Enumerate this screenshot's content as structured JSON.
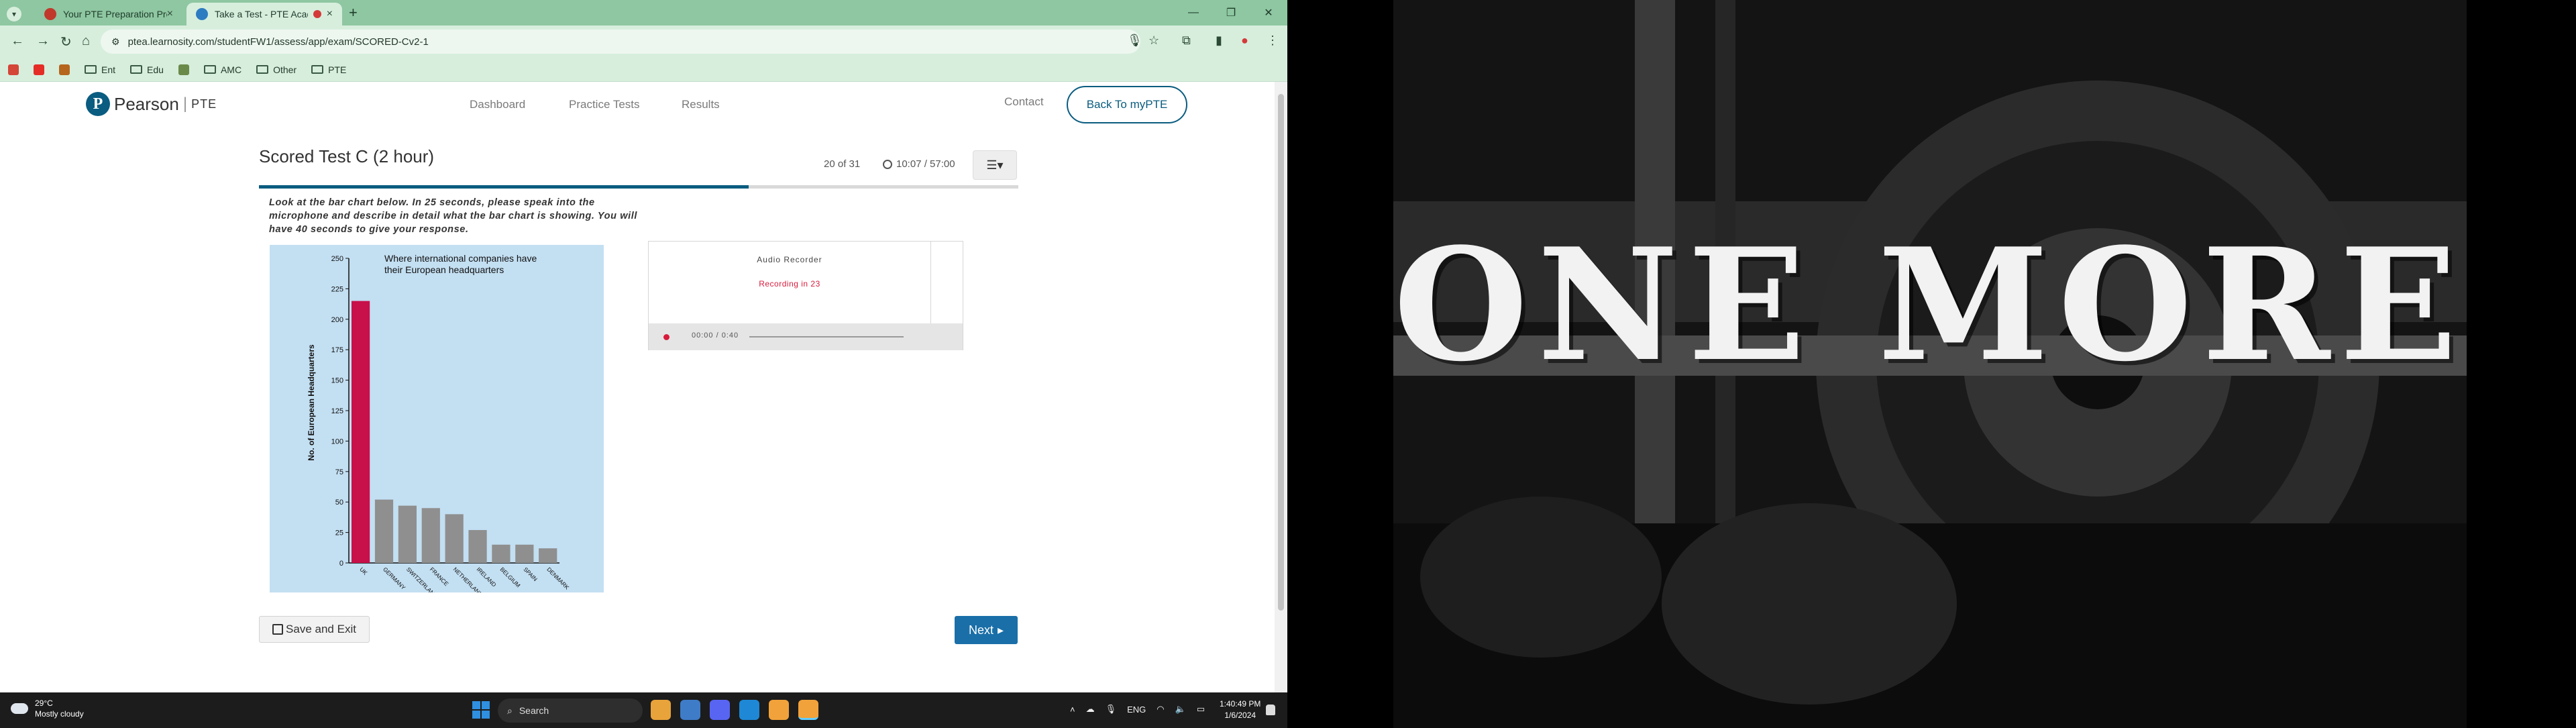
{
  "browser": {
    "tabs": [
      {
        "title": "Your PTE Preparation Product",
        "favicon_color": "#c0392b"
      },
      {
        "title": "Take a Test - PTE Academic",
        "favicon_color": "#2d7cc1"
      }
    ],
    "url": "ptea.learnosity.com/studentFW1/assess/app/exam/SCORED-Cv2-1",
    "bookmarks": [
      "Ent",
      "Edu",
      "AMC",
      "Other",
      "PTE"
    ]
  },
  "site": {
    "logo_name": "Pearson",
    "logo_product": "PTE",
    "nav": [
      "Dashboard",
      "Practice Tests",
      "Results"
    ],
    "contact": "Contact",
    "back_button": "Back To myPTE"
  },
  "test": {
    "title": "Scored Test C (2 hour)",
    "counter": "20 of 31",
    "timer": "10:07 / 57:00",
    "progress": 0.645,
    "instructions": "Look at the bar chart below. In 25 seconds, please speak into the microphone and describe in detail what the bar chart is showing. You will have 40 seconds to give your response."
  },
  "recorder": {
    "title": "Audio Recorder",
    "status": "Recording in 23",
    "time": "00:00 / 0:40"
  },
  "buttons": {
    "save_exit": "Save and Exit",
    "next": "Next"
  },
  "chart_data": {
    "type": "bar",
    "title": "Where international companies have their European headquarters",
    "ylabel": "No. of European Headquarters",
    "xlabel": "",
    "ylim": [
      0,
      250
    ],
    "yticks": [
      0,
      25,
      50,
      75,
      100,
      125,
      150,
      175,
      200,
      225,
      250
    ],
    "categories": [
      "UK",
      "GERMANY",
      "SWITZERLAND",
      "FRANCE",
      "NETHERLANDS",
      "IRELAND",
      "BELGIUM",
      "SPAIN",
      "DENMARK"
    ],
    "values": [
      215,
      52,
      47,
      45,
      40,
      27,
      15,
      15,
      12
    ],
    "colors": [
      "#c8104a",
      "#8f8f8f",
      "#8f8f8f",
      "#8f8f8f",
      "#8f8f8f",
      "#8f8f8f",
      "#8f8f8f",
      "#8f8f8f",
      "#8f8f8f"
    ]
  },
  "taskbar": {
    "temperature": "29°C",
    "weather": "Mostly cloudy",
    "search_placeholder": "Search",
    "language": "ENG",
    "time": "1:40:49 PM",
    "date": "1/6/2024"
  },
  "wallpaper": {
    "text": "ONE MORE"
  }
}
